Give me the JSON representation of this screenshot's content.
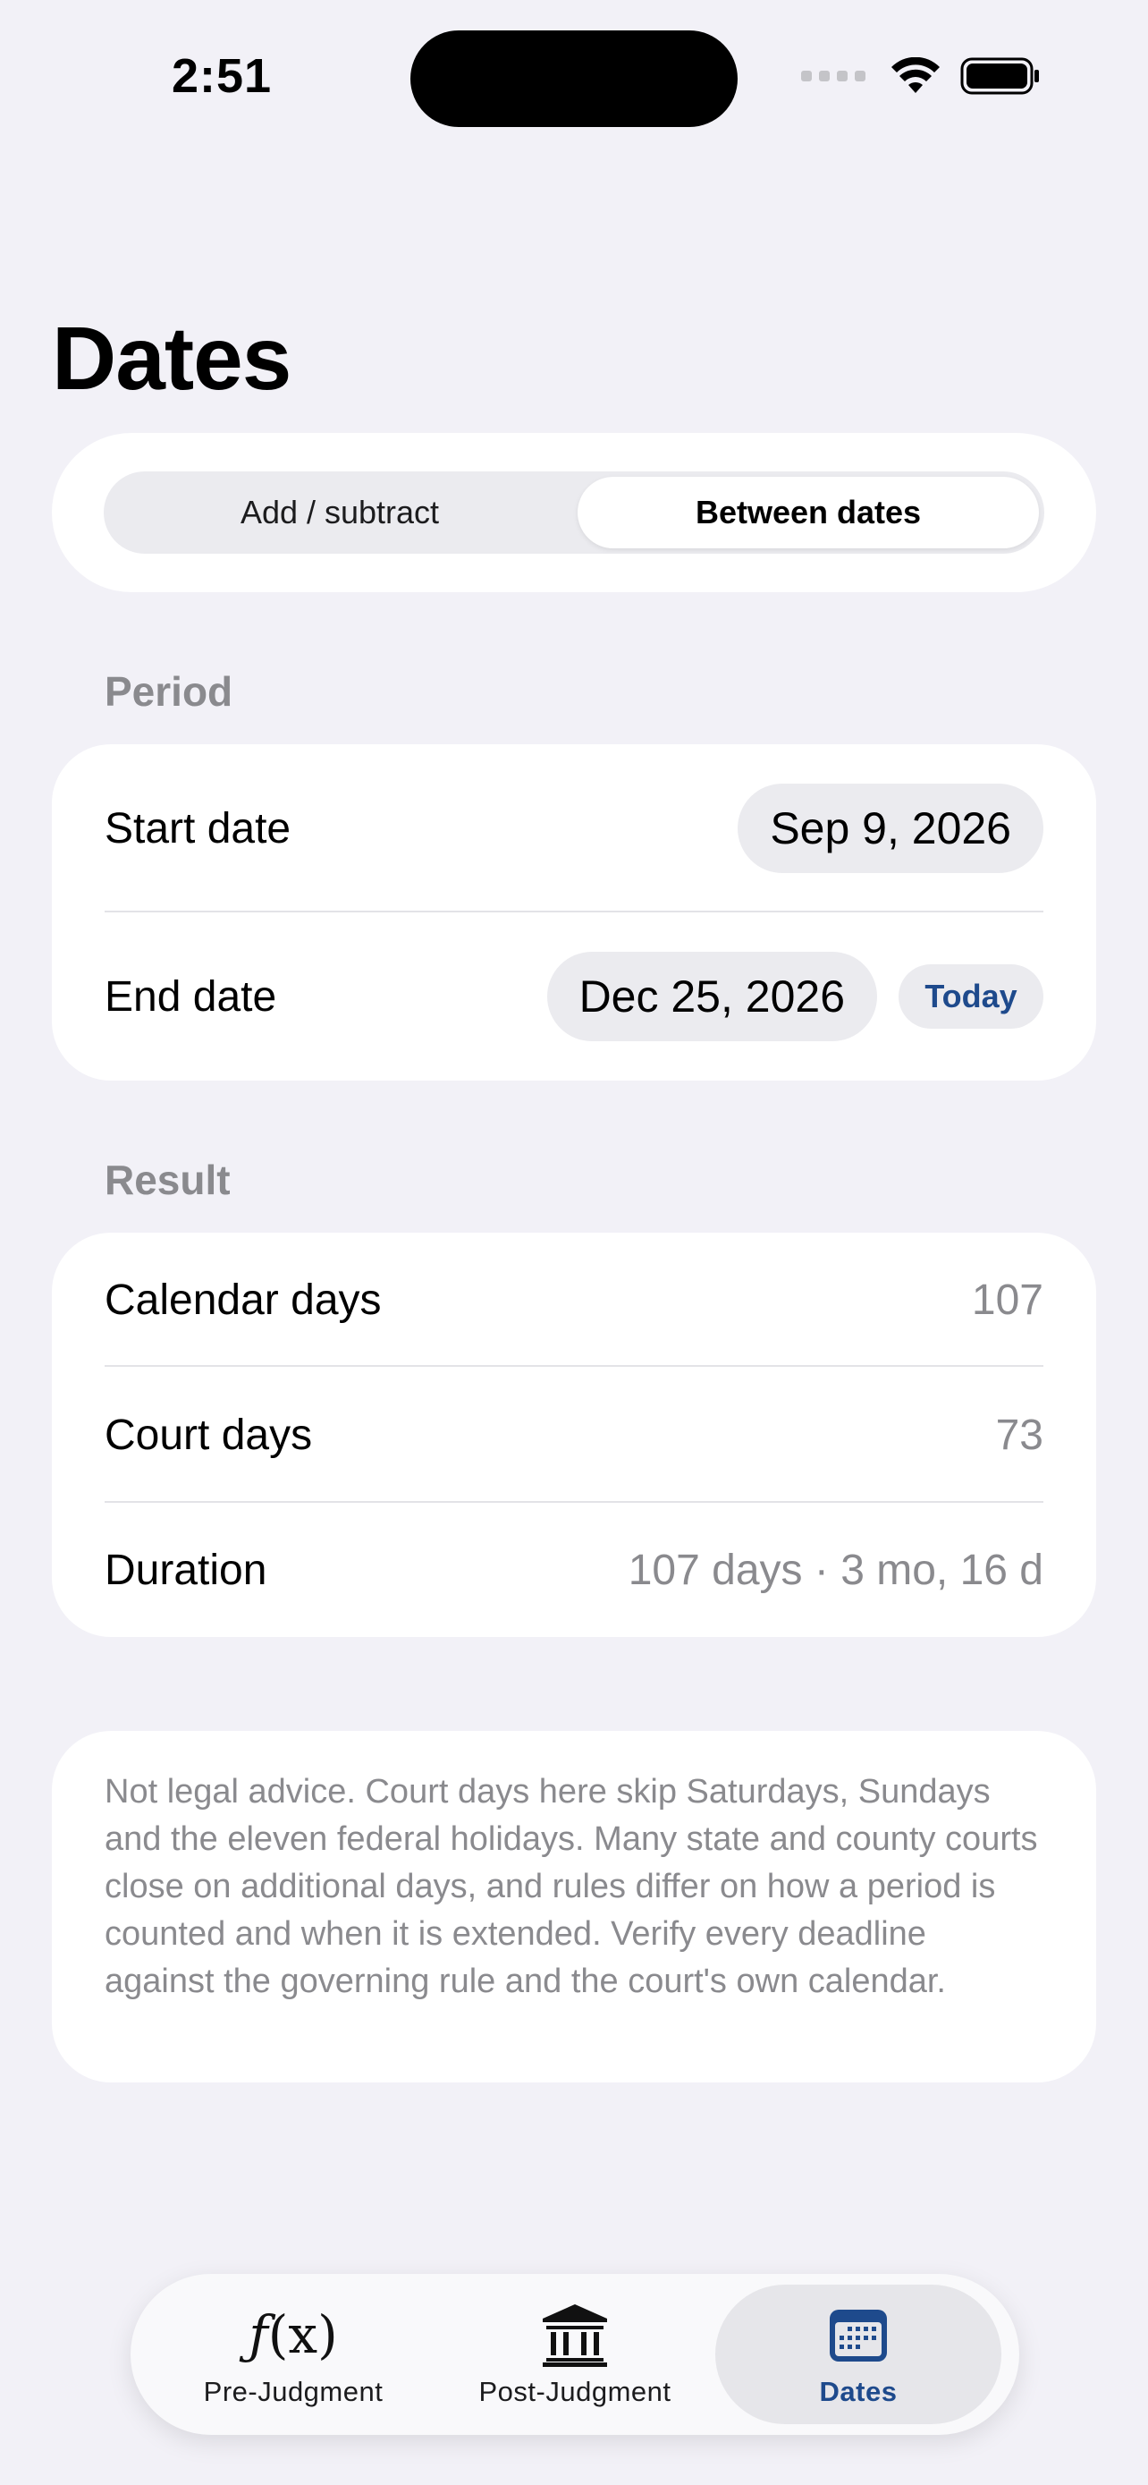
{
  "status_bar": {
    "time": "2:51"
  },
  "page": {
    "title": "Dates"
  },
  "segmented_control": {
    "options": [
      "Add / subtract",
      "Between dates"
    ],
    "selected": "Between dates"
  },
  "period": {
    "section_label": "Period",
    "start_date": {
      "label": "Start date",
      "value": "Sep 9, 2026"
    },
    "end_date": {
      "label": "End date",
      "value": "Dec 25, 2026",
      "today_button": "Today"
    }
  },
  "result": {
    "section_label": "Result",
    "rows": [
      {
        "label": "Calendar days",
        "value": "107"
      },
      {
        "label": "Court days",
        "value": "73"
      },
      {
        "label": "Duration",
        "value": "107 days · 3 mo, 16 d"
      }
    ]
  },
  "disclaimer": {
    "text": "Not legal advice. Court days here skip Saturdays, Sundays and the eleven federal holidays. Many state and county courts close on additional days, and rules differ on how a period is counted and when it is extended. Verify every deadline against the governing rule and the court's own calendar."
  },
  "tab_bar": {
    "tabs": [
      {
        "label": "Pre-Judgment",
        "icon": "function-icon"
      },
      {
        "label": "Post-Judgment",
        "icon": "courthouse-icon"
      },
      {
        "label": "Dates",
        "icon": "calendar-icon"
      }
    ],
    "active": "Dates"
  },
  "colors": {
    "background": "#F2F1F7",
    "card": "#FFFFFF",
    "accent": "#1E4A8C",
    "secondary_text": "#8A8A8E"
  }
}
